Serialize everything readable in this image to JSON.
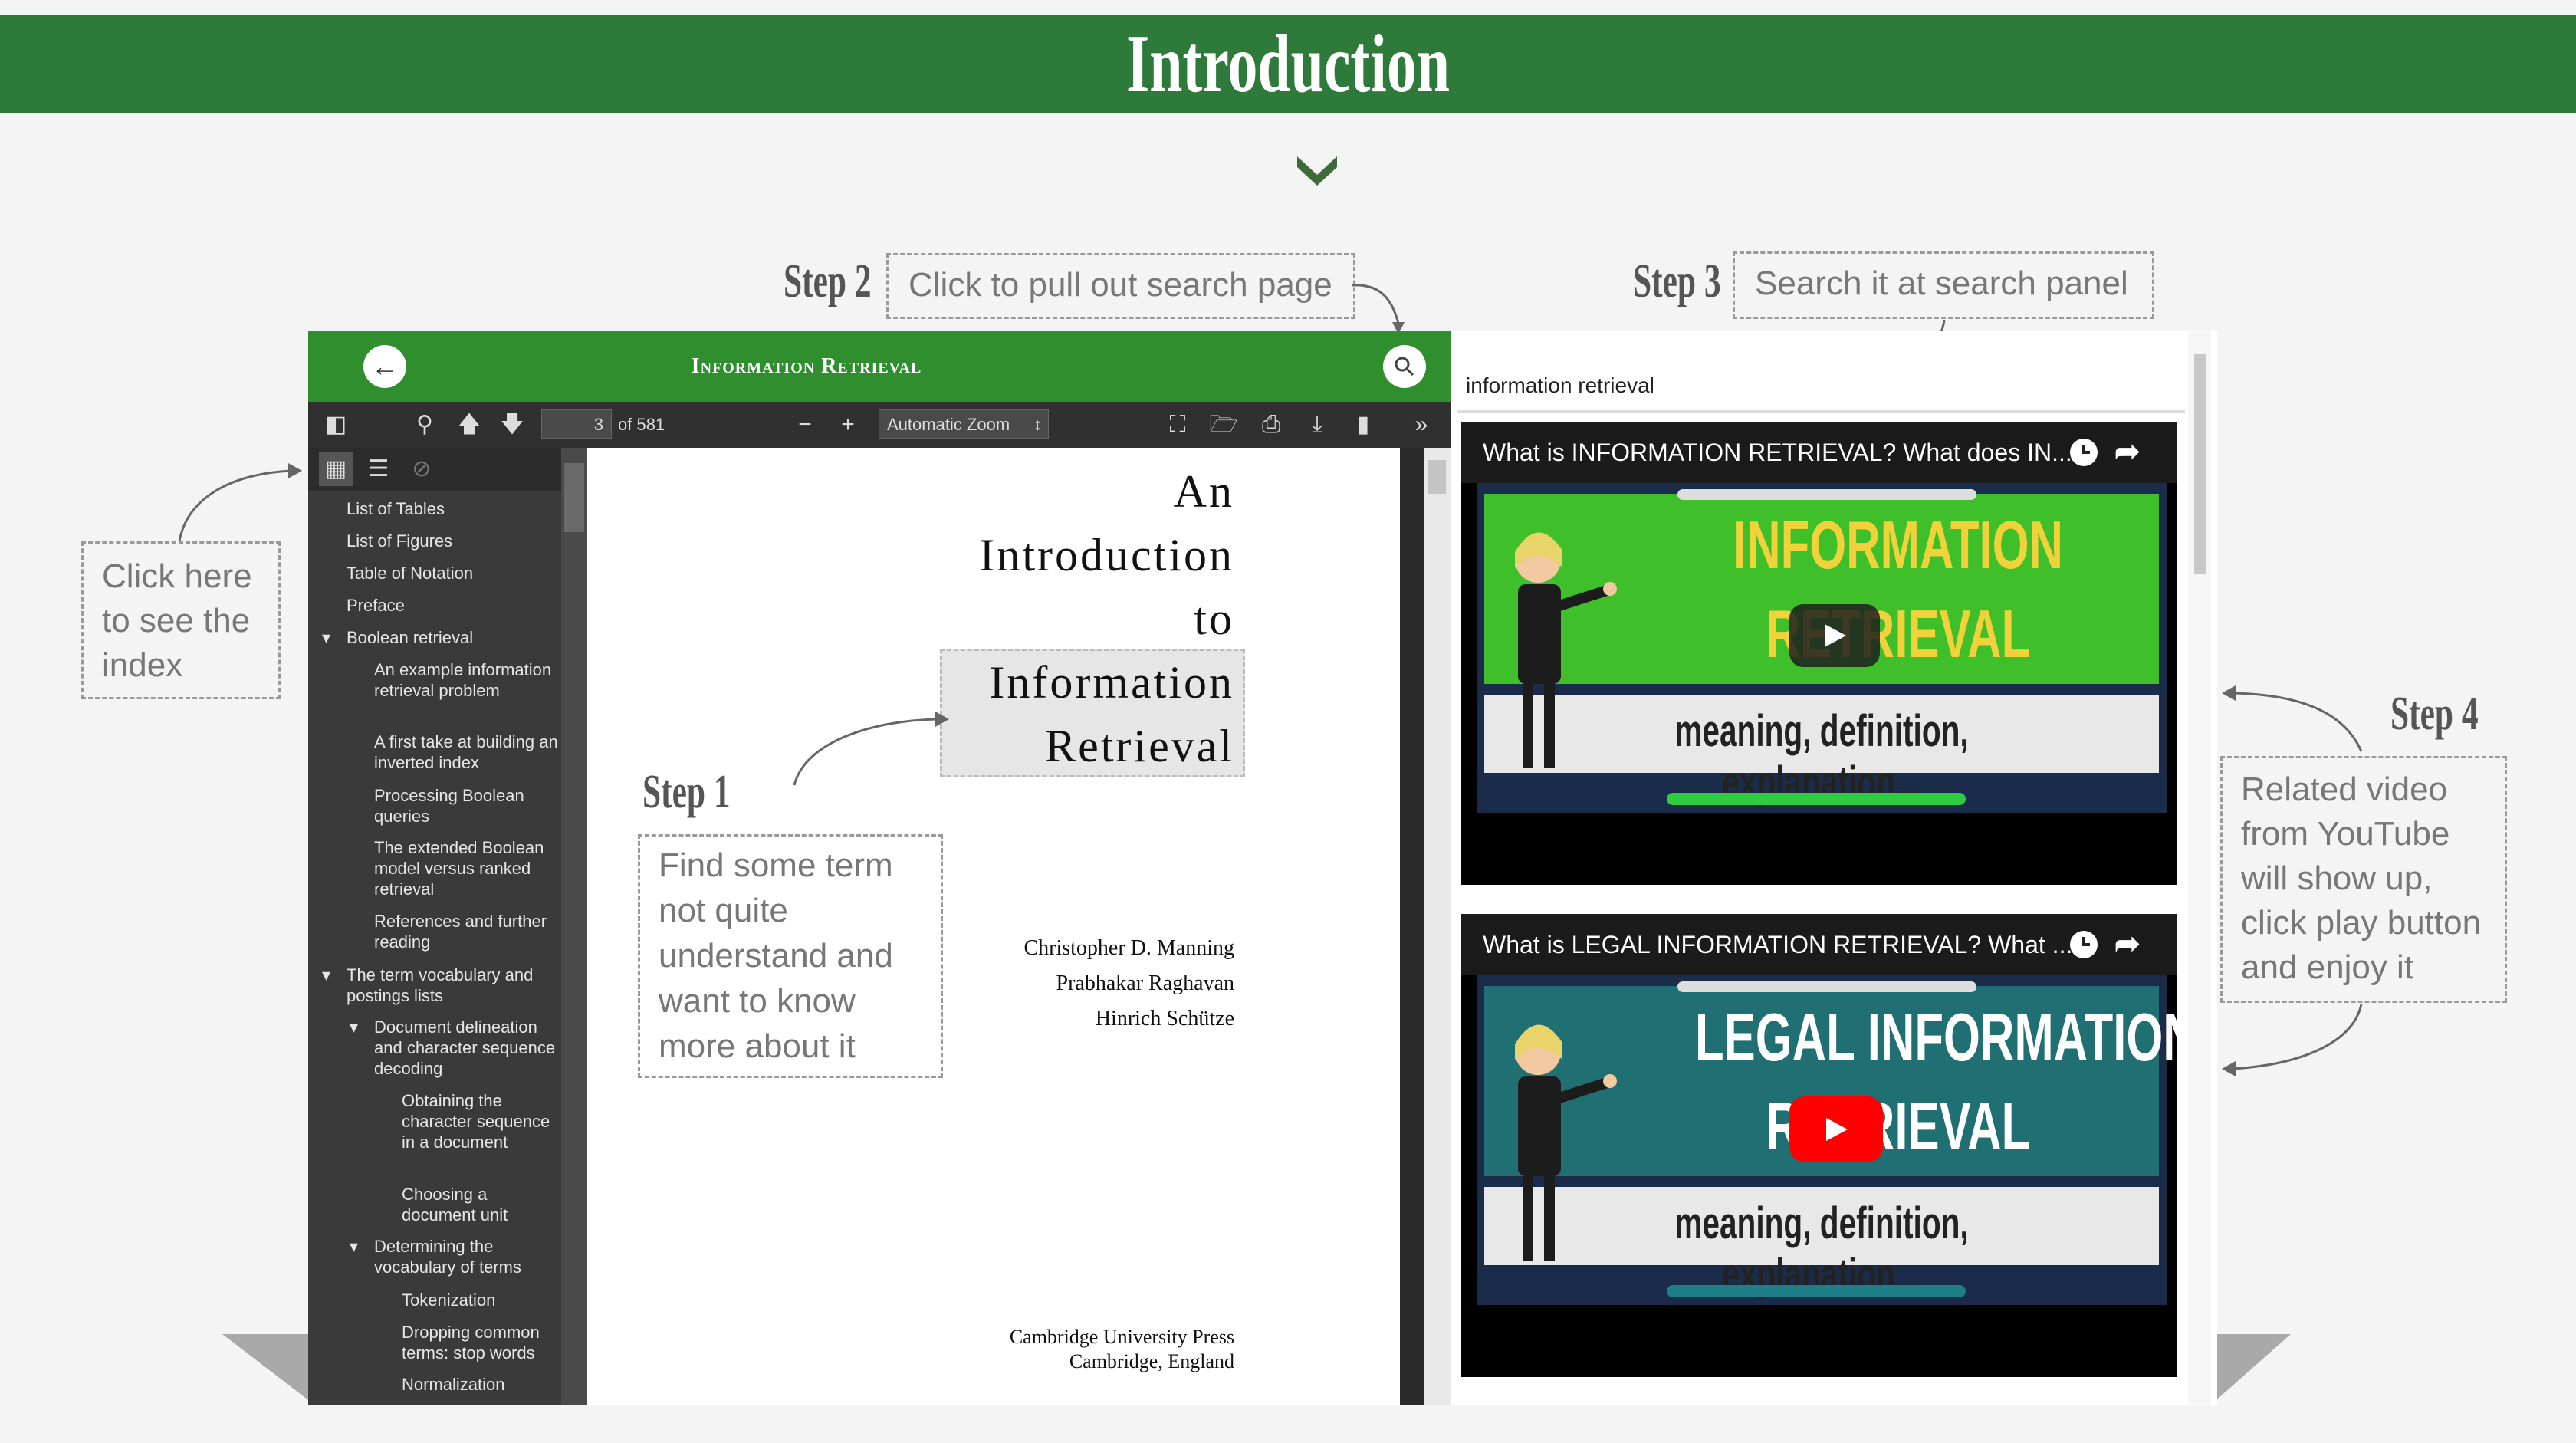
{
  "header": {
    "title": "Introduction"
  },
  "steps": {
    "step1": {
      "label": "Step 1",
      "text": "Find some term not quite understand and want to know more about it"
    },
    "step2": {
      "label": "Step 2",
      "text": "Click to pull out search page"
    },
    "step3": {
      "label": "Step 3",
      "text": "Search it at search panel"
    },
    "step4": {
      "label": "Step 4",
      "text": "Related video from YouTube will show up, click play button and enjoy it"
    },
    "index_note": {
      "text": "Click here to see the index"
    }
  },
  "pdf_viewer": {
    "title": "Information Retrieval",
    "page_current": "3",
    "page_total": "of 581",
    "zoom": "Automatic Zoom",
    "toc": [
      "List of Tables",
      "List of Figures",
      "Table of Notation",
      "Preface",
      "Boolean retrieval",
      "An example information retrieval problem",
      "A first take at building an inverted index",
      "Processing Boolean queries",
      "The extended Boolean model versus ranked retrieval",
      "References and further reading",
      "The term vocabulary and postings lists",
      "Document delineation and character sequence decoding",
      "Obtaining the character sequence in a document",
      "Choosing a document unit",
      "Determining the vocabulary of terms",
      "Tokenization",
      "Dropping common terms: stop words",
      "Normalization"
    ],
    "page": {
      "title_lines": [
        "An",
        "Introduction",
        "to",
        "Information",
        "Retrieval"
      ],
      "authors": [
        "Christopher D. Manning",
        "Prabhakar Raghavan",
        "Hinrich Schütze"
      ],
      "publisher": [
        "Cambridge University Press",
        "Cambridge, England"
      ]
    }
  },
  "search_panel": {
    "query": "information retrieval",
    "videos": [
      {
        "title": "What is INFORMATION RETRIEVAL? What does IN...",
        "thumb_line1": "INFORMATION",
        "thumb_line2": "RETRIEVAL",
        "thumb_caption": "meaning, definition, explanation...",
        "thumb_color": "#3fbf2a"
      },
      {
        "title": "What is LEGAL INFORMATION RETRIEVAL? What ...",
        "thumb_line1": "LEGAL INFORMATION",
        "thumb_line2": "RETRIEVAL",
        "thumb_caption": "meaning, definition, explanation...",
        "thumb_color": "#1f6f73"
      }
    ]
  },
  "colors": {
    "banner": "#2e7a3a",
    "viewer_header": "#2f8f2f",
    "youtube_red": "#ff0000"
  },
  "icons": [
    "chevron-down-icon",
    "back-arrow-icon",
    "search-icon",
    "sidebar-toggle-icon",
    "find-icon",
    "previous-page-icon",
    "next-page-icon",
    "zoom-out-icon",
    "zoom-in-icon",
    "fullscreen-icon",
    "open-file-icon",
    "print-icon",
    "download-icon",
    "bookmark-icon",
    "tools-icon",
    "thumbnails-icon",
    "outline-icon",
    "attachments-icon",
    "clock-icon",
    "share-icon",
    "play-icon"
  ]
}
